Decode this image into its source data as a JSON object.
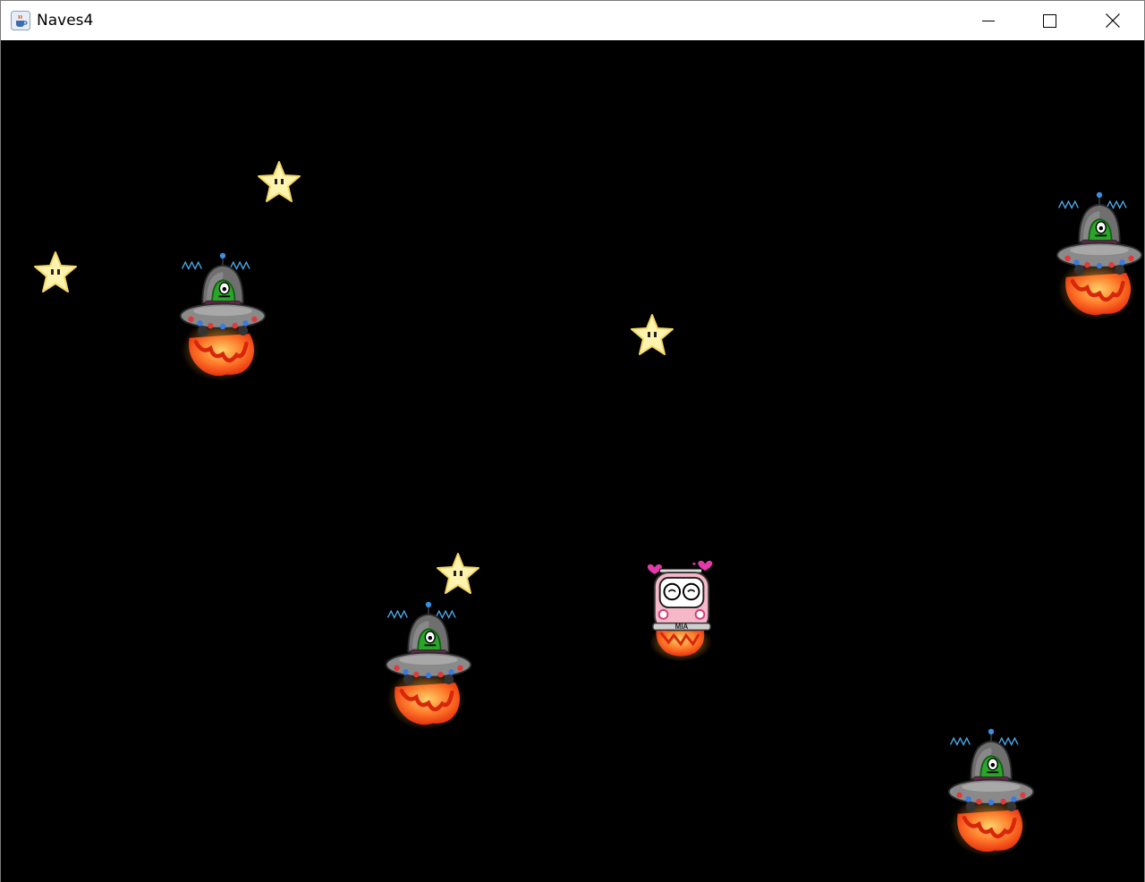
{
  "window": {
    "title": "Naves4",
    "icon": "java-coffee-cup-icon",
    "controls": [
      "minimize-icon",
      "maximize-icon",
      "close-icon"
    ]
  },
  "game": {
    "background_color": "#000000",
    "star_color": "#fff3b0",
    "ufo_count": 4,
    "star_count": 4,
    "player_plate": "MIA",
    "colors": {
      "ufo_body": "#8a8a8a",
      "alien": "#2aa52a",
      "flame": "#ff5a1f",
      "antenna_wave": "#4aa8e8",
      "player_body": "#f6b8c8",
      "heart": "#e23aa8"
    }
  }
}
